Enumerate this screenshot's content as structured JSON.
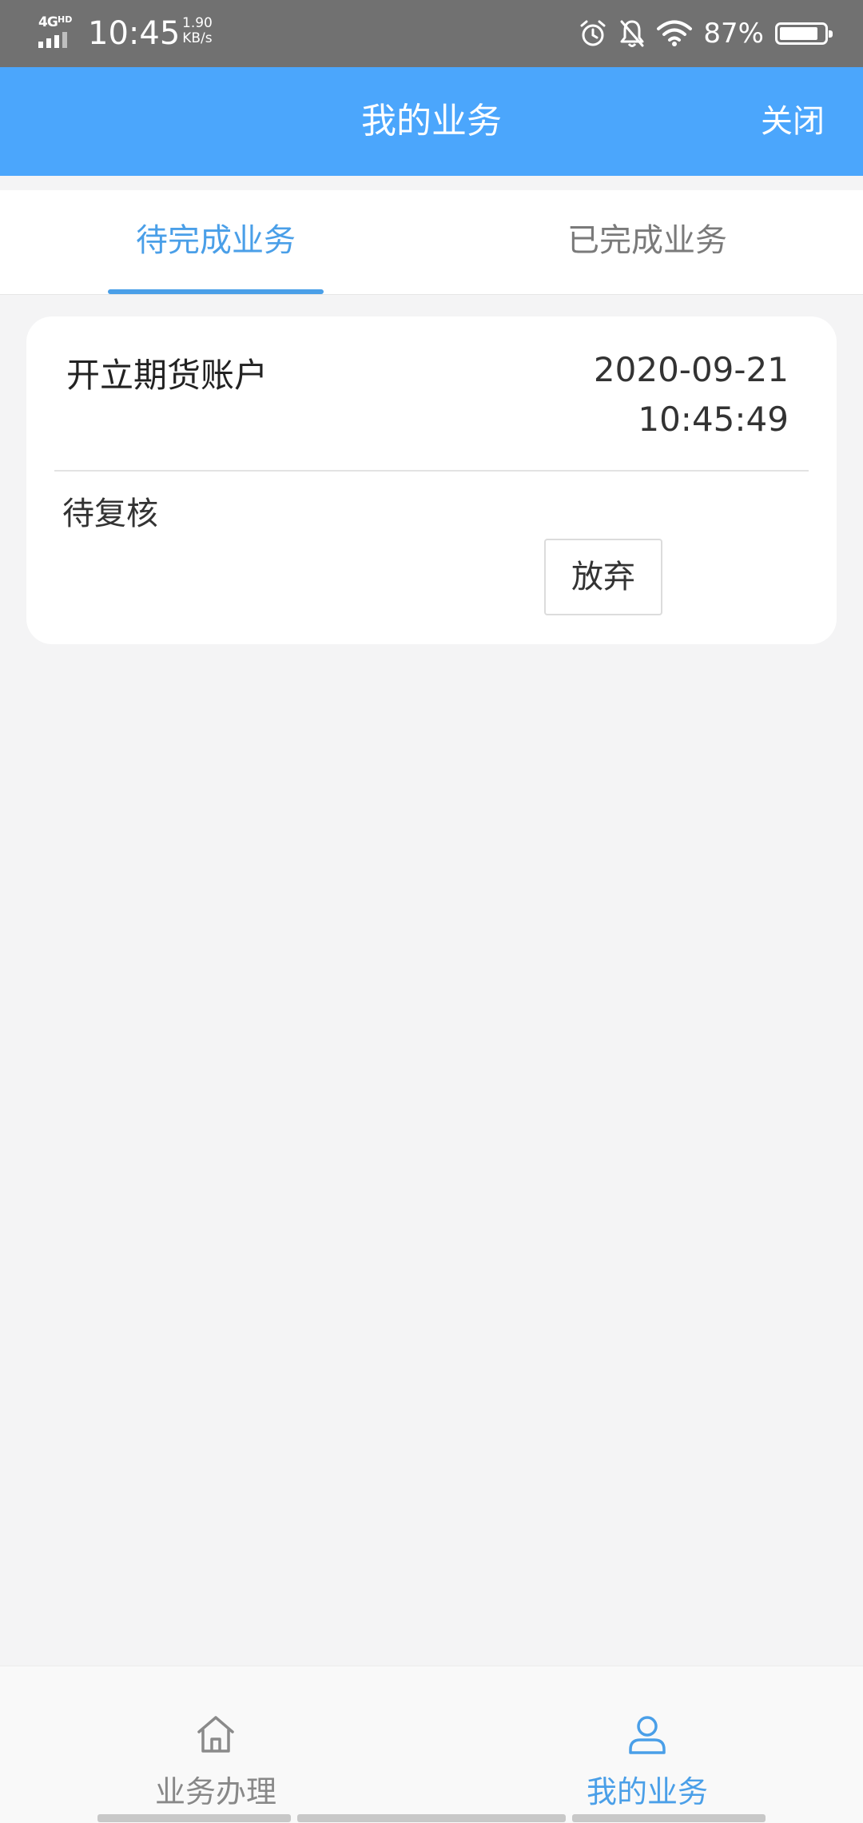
{
  "status_bar": {
    "network": "4G",
    "network_sup": "HD",
    "time": "10:45",
    "speed_value": "1.90",
    "speed_unit": "KB/s",
    "battery_percent": "87%",
    "battery_level": 0.87
  },
  "header": {
    "title": "我的业务",
    "close_label": "关闭"
  },
  "tabs": [
    {
      "label": "待完成业务",
      "active": true
    },
    {
      "label": "已完成业务",
      "active": false
    }
  ],
  "business_list": [
    {
      "name": "开立期货账户",
      "date": "2020-09-21",
      "time": "10:45:49",
      "status": "待复核",
      "action_label": "放弃"
    }
  ],
  "bottom_nav": [
    {
      "label": "业务办理",
      "icon": "home-icon",
      "active": false
    },
    {
      "label": "我的业务",
      "icon": "user-icon",
      "active": true
    }
  ],
  "colors": {
    "header_bg": "#4ba6fc",
    "accent": "#4a9fe8",
    "status_bar_bg": "#717171",
    "page_bg": "#f4f4f5"
  }
}
